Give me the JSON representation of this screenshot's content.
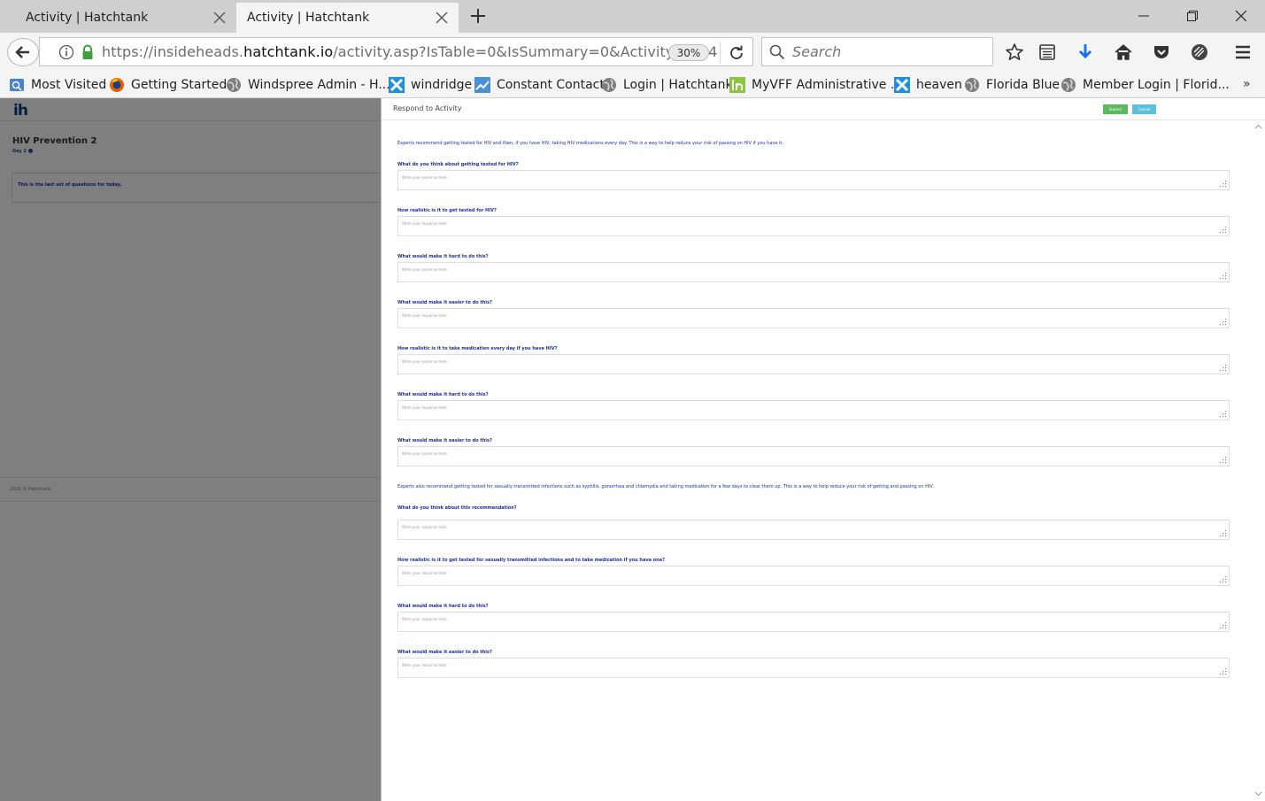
{
  "browser": {
    "tabs": [
      {
        "title": "Activity | Hatchtank",
        "active": false
      },
      {
        "title": "Activity | Hatchtank",
        "active": true
      }
    ],
    "url": {
      "prefix": "https://insideheads.",
      "host": "hatchtank.io",
      "path": "/activity.asp?IsTable=0&IsSummary=0&ActivityId=14"
    },
    "zoom": "30%",
    "search_placeholder": "Search",
    "bookmarks": [
      {
        "label": "Most Visited",
        "icon": "bookmark-folder-icon"
      },
      {
        "label": "Getting Started",
        "icon": "firefox-icon"
      },
      {
        "label": "Windspree Admin - H...",
        "icon": "globe-icon"
      },
      {
        "label": "windridge",
        "icon": "windridge-icon"
      },
      {
        "label": "Constant Contact",
        "icon": "constant-contact-icon"
      },
      {
        "label": "Login | Hatchtank",
        "icon": "globe-icon"
      },
      {
        "label": "MyVFF Administrative ...",
        "icon": "hatchtank-icon"
      },
      {
        "label": "heaven",
        "icon": "windridge-icon"
      },
      {
        "label": "Florida Blue",
        "icon": "globe-icon"
      },
      {
        "label": "Member Login | Florid...",
        "icon": "globe-icon"
      }
    ],
    "bookmark_overflow": "»"
  },
  "background_app": {
    "logo": "ih",
    "title": "HIV Prevention 2",
    "day": "Day 2",
    "card_text": "This is the last set of questions for today.",
    "footer": "2016 © Hatchtank"
  },
  "modal": {
    "title": "Respond to Activity",
    "submit_label": "Submit",
    "cancel_label": "Cancel",
    "placeholder": "Write your response here",
    "intro_1": "Experts recommend getting tested for HIV and then, if you have HIV, taking HIV medications every day. This is a way to help reduce your risk of passing on HIV if you have it.",
    "intro_2": "Experts also recommend getting tested for sexually transmitted infections such as syphilis, gonorrhea and chlamydia and taking medication for a few days to clear them up. This is a way to help reduce your risk of getting and passing on HIV.",
    "questions": [
      "What do you think about getting tested for HIV?",
      "How realistic is it to get tested for HIV?",
      "What would make it hard to do this?",
      "What would make it easier to do this?",
      "How realistic is it to take medication every day if you have HIV?",
      "What would make it hard to do this?",
      "What would make it easier to do this?",
      "What do you think about this recommendation?",
      "How realistic is it to get tested for sexually transmitted infections and to take medication if you have one?",
      "What would make it hard to do this?",
      "What would make it easier to do this?"
    ]
  }
}
